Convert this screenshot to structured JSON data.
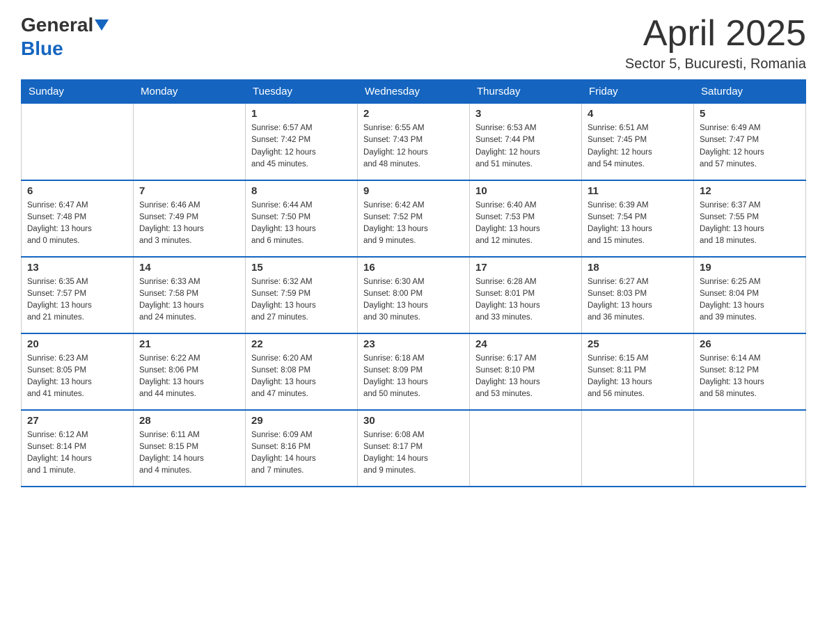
{
  "logo": {
    "general": "General",
    "blue": "Blue"
  },
  "title": "April 2025",
  "subtitle": "Sector 5, Bucuresti, Romania",
  "weekdays": [
    "Sunday",
    "Monday",
    "Tuesday",
    "Wednesday",
    "Thursday",
    "Friday",
    "Saturday"
  ],
  "weeks": [
    [
      {
        "day": "",
        "info": ""
      },
      {
        "day": "",
        "info": ""
      },
      {
        "day": "1",
        "info": "Sunrise: 6:57 AM\nSunset: 7:42 PM\nDaylight: 12 hours\nand 45 minutes."
      },
      {
        "day": "2",
        "info": "Sunrise: 6:55 AM\nSunset: 7:43 PM\nDaylight: 12 hours\nand 48 minutes."
      },
      {
        "day": "3",
        "info": "Sunrise: 6:53 AM\nSunset: 7:44 PM\nDaylight: 12 hours\nand 51 minutes."
      },
      {
        "day": "4",
        "info": "Sunrise: 6:51 AM\nSunset: 7:45 PM\nDaylight: 12 hours\nand 54 minutes."
      },
      {
        "day": "5",
        "info": "Sunrise: 6:49 AM\nSunset: 7:47 PM\nDaylight: 12 hours\nand 57 minutes."
      }
    ],
    [
      {
        "day": "6",
        "info": "Sunrise: 6:47 AM\nSunset: 7:48 PM\nDaylight: 13 hours\nand 0 minutes."
      },
      {
        "day": "7",
        "info": "Sunrise: 6:46 AM\nSunset: 7:49 PM\nDaylight: 13 hours\nand 3 minutes."
      },
      {
        "day": "8",
        "info": "Sunrise: 6:44 AM\nSunset: 7:50 PM\nDaylight: 13 hours\nand 6 minutes."
      },
      {
        "day": "9",
        "info": "Sunrise: 6:42 AM\nSunset: 7:52 PM\nDaylight: 13 hours\nand 9 minutes."
      },
      {
        "day": "10",
        "info": "Sunrise: 6:40 AM\nSunset: 7:53 PM\nDaylight: 13 hours\nand 12 minutes."
      },
      {
        "day": "11",
        "info": "Sunrise: 6:39 AM\nSunset: 7:54 PM\nDaylight: 13 hours\nand 15 minutes."
      },
      {
        "day": "12",
        "info": "Sunrise: 6:37 AM\nSunset: 7:55 PM\nDaylight: 13 hours\nand 18 minutes."
      }
    ],
    [
      {
        "day": "13",
        "info": "Sunrise: 6:35 AM\nSunset: 7:57 PM\nDaylight: 13 hours\nand 21 minutes."
      },
      {
        "day": "14",
        "info": "Sunrise: 6:33 AM\nSunset: 7:58 PM\nDaylight: 13 hours\nand 24 minutes."
      },
      {
        "day": "15",
        "info": "Sunrise: 6:32 AM\nSunset: 7:59 PM\nDaylight: 13 hours\nand 27 minutes."
      },
      {
        "day": "16",
        "info": "Sunrise: 6:30 AM\nSunset: 8:00 PM\nDaylight: 13 hours\nand 30 minutes."
      },
      {
        "day": "17",
        "info": "Sunrise: 6:28 AM\nSunset: 8:01 PM\nDaylight: 13 hours\nand 33 minutes."
      },
      {
        "day": "18",
        "info": "Sunrise: 6:27 AM\nSunset: 8:03 PM\nDaylight: 13 hours\nand 36 minutes."
      },
      {
        "day": "19",
        "info": "Sunrise: 6:25 AM\nSunset: 8:04 PM\nDaylight: 13 hours\nand 39 minutes."
      }
    ],
    [
      {
        "day": "20",
        "info": "Sunrise: 6:23 AM\nSunset: 8:05 PM\nDaylight: 13 hours\nand 41 minutes."
      },
      {
        "day": "21",
        "info": "Sunrise: 6:22 AM\nSunset: 8:06 PM\nDaylight: 13 hours\nand 44 minutes."
      },
      {
        "day": "22",
        "info": "Sunrise: 6:20 AM\nSunset: 8:08 PM\nDaylight: 13 hours\nand 47 minutes."
      },
      {
        "day": "23",
        "info": "Sunrise: 6:18 AM\nSunset: 8:09 PM\nDaylight: 13 hours\nand 50 minutes."
      },
      {
        "day": "24",
        "info": "Sunrise: 6:17 AM\nSunset: 8:10 PM\nDaylight: 13 hours\nand 53 minutes."
      },
      {
        "day": "25",
        "info": "Sunrise: 6:15 AM\nSunset: 8:11 PM\nDaylight: 13 hours\nand 56 minutes."
      },
      {
        "day": "26",
        "info": "Sunrise: 6:14 AM\nSunset: 8:12 PM\nDaylight: 13 hours\nand 58 minutes."
      }
    ],
    [
      {
        "day": "27",
        "info": "Sunrise: 6:12 AM\nSunset: 8:14 PM\nDaylight: 14 hours\nand 1 minute."
      },
      {
        "day": "28",
        "info": "Sunrise: 6:11 AM\nSunset: 8:15 PM\nDaylight: 14 hours\nand 4 minutes."
      },
      {
        "day": "29",
        "info": "Sunrise: 6:09 AM\nSunset: 8:16 PM\nDaylight: 14 hours\nand 7 minutes."
      },
      {
        "day": "30",
        "info": "Sunrise: 6:08 AM\nSunset: 8:17 PM\nDaylight: 14 hours\nand 9 minutes."
      },
      {
        "day": "",
        "info": ""
      },
      {
        "day": "",
        "info": ""
      },
      {
        "day": "",
        "info": ""
      }
    ]
  ]
}
